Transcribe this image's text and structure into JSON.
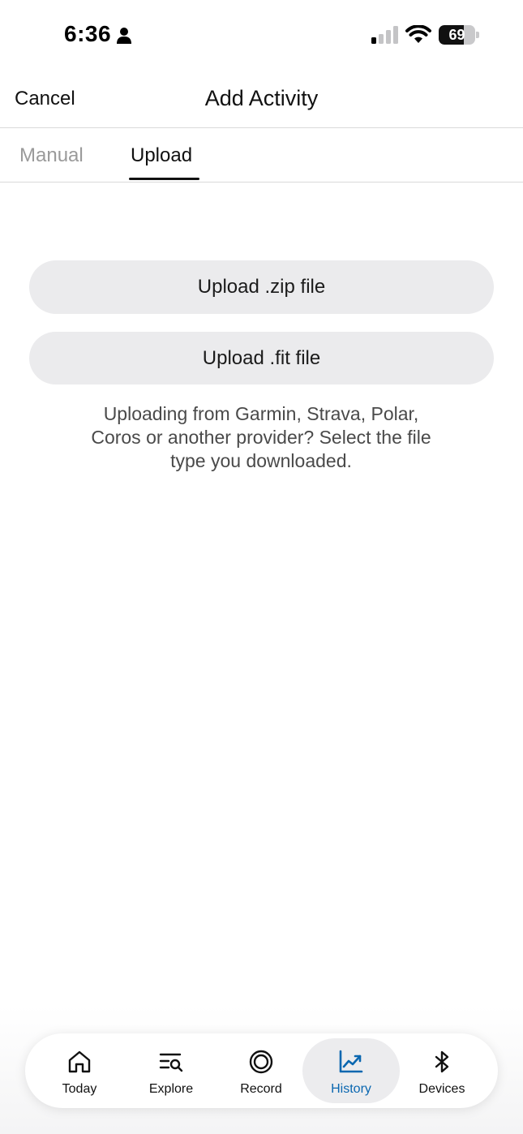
{
  "status_bar": {
    "time": "6:36",
    "battery": "69",
    "battery_level": 0.69
  },
  "header": {
    "cancel_label": "Cancel",
    "title": "Add Activity"
  },
  "tabs": [
    {
      "label": "Manual",
      "selected": false
    },
    {
      "label": "Upload",
      "selected": true
    }
  ],
  "upload": {
    "zip_label": "Upload .zip file",
    "fit_label": "Upload .fit file",
    "helper_line1": "Uploading from Garmin, Strava, Polar,",
    "helper_line2": "Coros or another provider? Select the file",
    "helper_line3": "type you downloaded."
  },
  "bottom_nav": {
    "items": [
      {
        "label": "Today",
        "icon": "home-icon",
        "active": false
      },
      {
        "label": "Explore",
        "icon": "explore-search-icon",
        "active": false
      },
      {
        "label": "Record",
        "icon": "record-icon",
        "active": false
      },
      {
        "label": "History",
        "icon": "chart-trend-icon",
        "active": true
      },
      {
        "label": "Devices",
        "icon": "bluetooth-icon",
        "active": false
      }
    ]
  },
  "colors": {
    "accent": "#0a67b0",
    "button_bg": "#ebebed",
    "inactive_tab": "#9a9a9a"
  }
}
